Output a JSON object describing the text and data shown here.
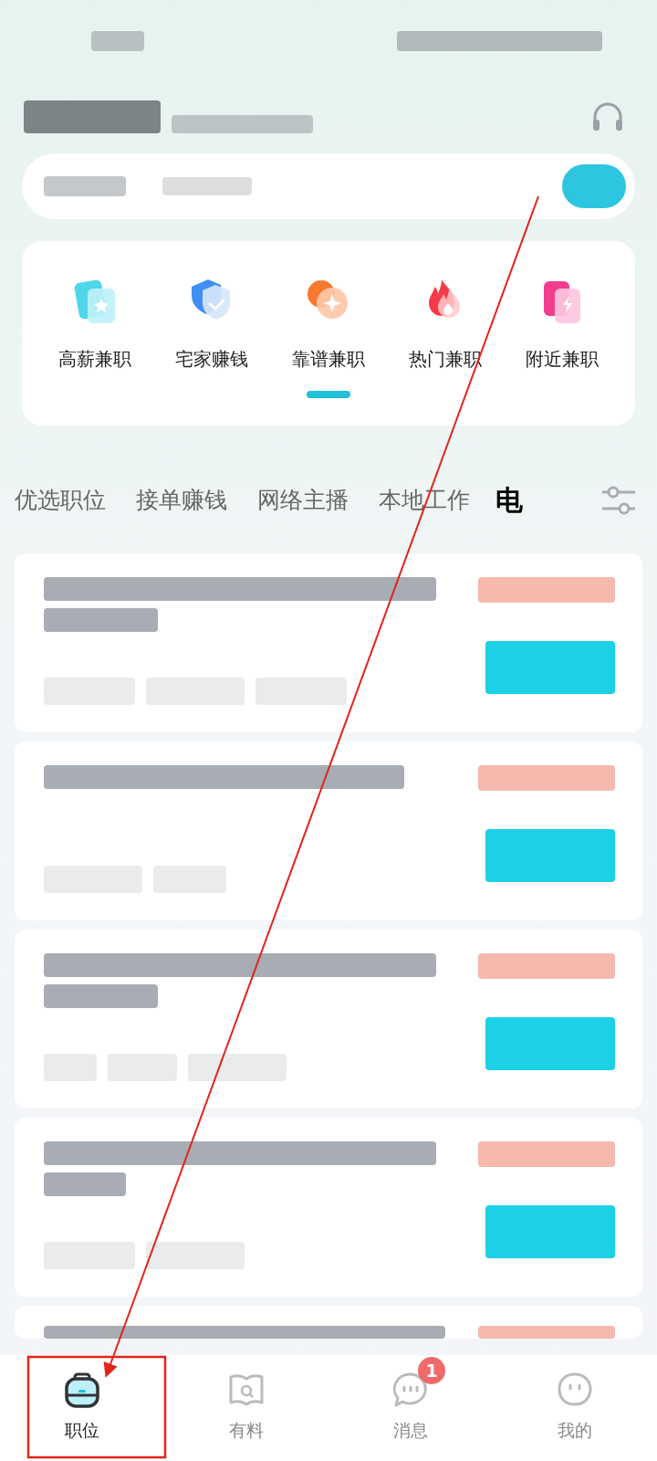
{
  "categories": [
    {
      "label": "高薪兼职",
      "kind": "cards_star"
    },
    {
      "label": "宅家赚钱",
      "kind": "shield_check"
    },
    {
      "label": "靠谱兼职",
      "kind": "coins_sparkle"
    },
    {
      "label": "热门兼职",
      "kind": "flame"
    },
    {
      "label": "附近兼职",
      "kind": "cards_bolt"
    }
  ],
  "tabs": [
    {
      "label": "优选职位",
      "selected": false
    },
    {
      "label": "接单赚钱",
      "selected": false
    },
    {
      "label": "网络主播",
      "selected": false
    },
    {
      "label": "本地工作",
      "selected": false
    },
    {
      "label": "电",
      "selected": true
    }
  ],
  "jobs": [
    {
      "kind": "blurred"
    },
    {
      "kind": "blurred"
    },
    {
      "kind": "blurred"
    },
    {
      "kind": "blurred"
    },
    {
      "kind": "cut_off"
    }
  ],
  "bottom_nav": [
    {
      "label": "职位",
      "selected": true,
      "kind": "case"
    },
    {
      "label": "有料",
      "selected": false,
      "kind": "book"
    },
    {
      "label": "消息",
      "selected": false,
      "kind": "chat",
      "badge": "1"
    },
    {
      "label": "我的",
      "selected": false,
      "kind": "face"
    }
  ]
}
